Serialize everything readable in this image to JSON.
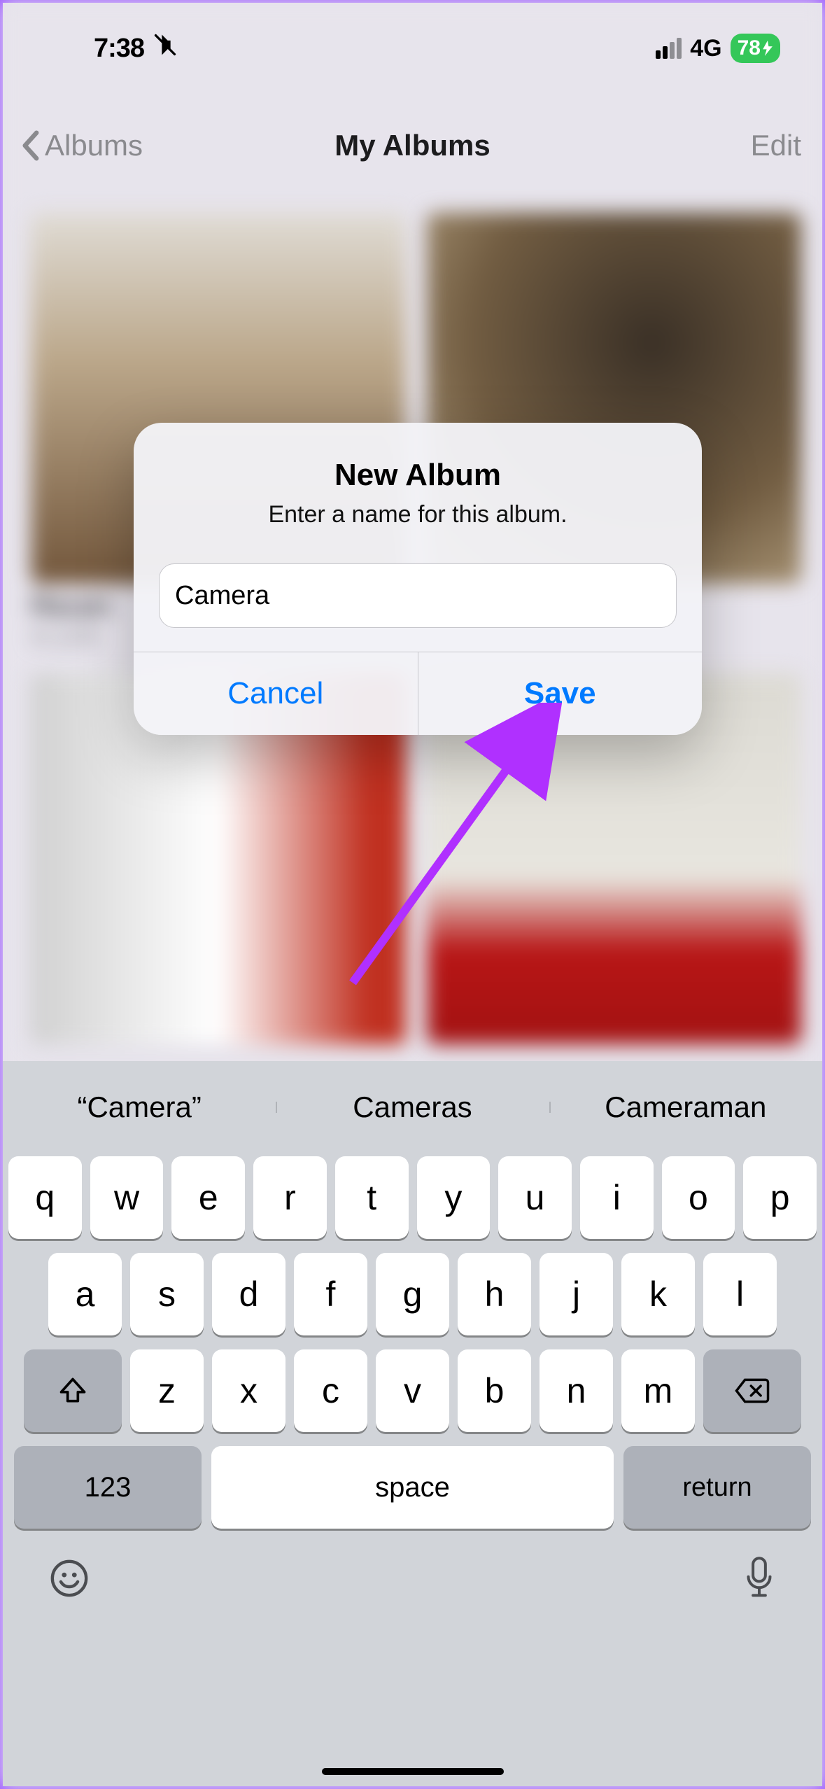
{
  "status": {
    "time": "7:38",
    "network": "4G",
    "battery": "78"
  },
  "nav": {
    "back_label": "Albums",
    "title": "My Albums",
    "edit_label": "Edit"
  },
  "albums": {
    "recent_name": "Recen",
    "recent_count": "4,124"
  },
  "dialog": {
    "title": "New Album",
    "message": "Enter a name for this album.",
    "input_value": "Camera",
    "cancel": "Cancel",
    "save": "Save"
  },
  "suggestions": {
    "s1": "“Camera”",
    "s2": "Cameras",
    "s3": "Cameraman"
  },
  "keys": {
    "row1": [
      "q",
      "w",
      "e",
      "r",
      "t",
      "y",
      "u",
      "i",
      "o",
      "p"
    ],
    "row2": [
      "a",
      "s",
      "d",
      "f",
      "g",
      "h",
      "j",
      "k",
      "l"
    ],
    "row3": [
      "z",
      "x",
      "c",
      "v",
      "b",
      "n",
      "m"
    ],
    "num": "123",
    "space": "space",
    "return": "return"
  }
}
